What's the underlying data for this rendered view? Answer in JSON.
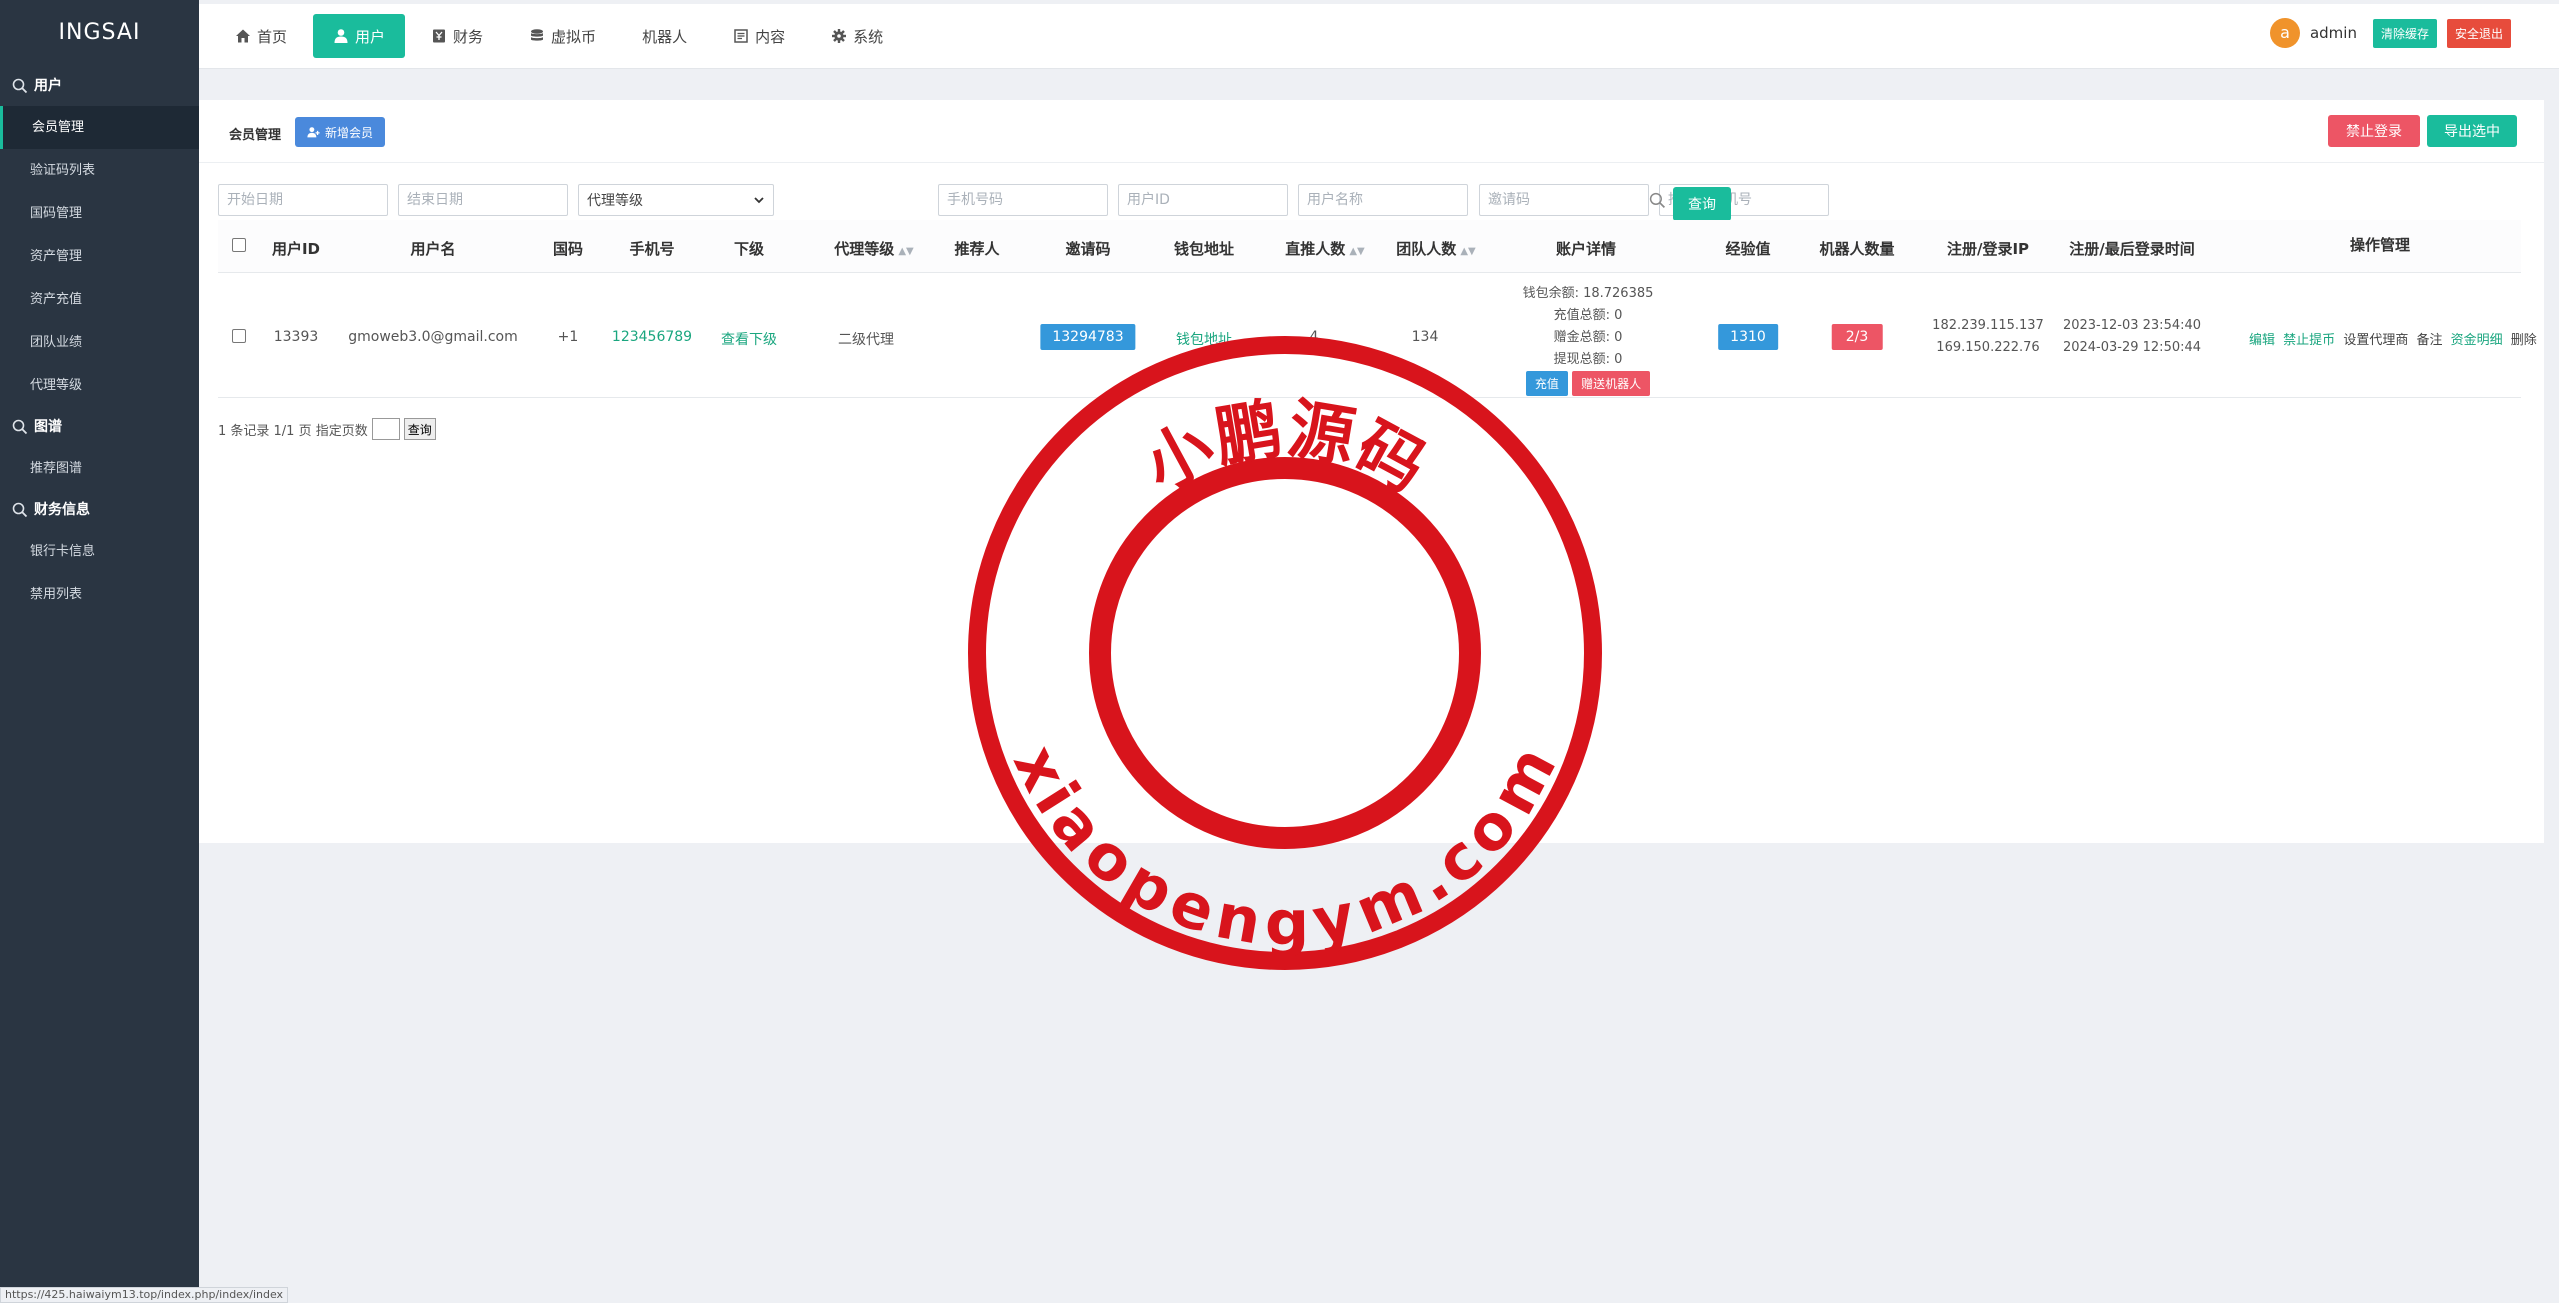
{
  "brand": "INGSAI",
  "sidebar": {
    "groups": [
      {
        "label": "用户",
        "items": [
          "会员管理",
          "验证码列表",
          "国码管理",
          "资产管理",
          "资产充值",
          "团队业绩",
          "代理等级"
        ]
      },
      {
        "label": "图谱",
        "items": [
          "推荐图谱"
        ]
      },
      {
        "label": "财务信息",
        "items": [
          "银行卡信息",
          "禁用列表"
        ]
      }
    ]
  },
  "topnav": {
    "tabs": [
      "首页",
      "用户",
      "财务",
      "虚拟币",
      "机器人",
      "内容",
      "系统"
    ],
    "avatar_letter": "a",
    "user": "admin",
    "clear_cache": "清除缓存",
    "logout": "安全退出"
  },
  "panel": {
    "title": "会员管理",
    "add_member": "新增会员",
    "ban_login": "禁止登录",
    "export_selected": "导出选中"
  },
  "filters": {
    "start_date": "开始日期",
    "end_date": "结束日期",
    "agent_level": "代理等级",
    "phone": "手机号码",
    "user_id": "用户ID",
    "user_name": "用户名称",
    "invite_code": "邀请码",
    "referrer_phone": "推荐人手机号",
    "query": "查询"
  },
  "table": {
    "headers": [
      "用户ID",
      "用户名",
      "国码",
      "手机号",
      "下级",
      "代理等级",
      "推荐人",
      "邀请码",
      "钱包地址",
      "直推人数",
      "团队人数",
      "账户详情",
      "经验值",
      "机器人数量",
      "注册/登录IP",
      "注册/最后登录时间",
      "操作管理"
    ],
    "row": {
      "id": "13393",
      "username": "gmoweb3.0@gmail.com",
      "country_code": "+1",
      "phone": "123456789",
      "subordinate": "查看下级",
      "agent_level": "二级代理",
      "referrer": "",
      "invite_code": "13294783",
      "wallet": "钱包地址",
      "direct": "4",
      "team": "134",
      "wallet_balance": "钱包余额: 18.726385",
      "recharge_total": "充值总额: 0",
      "gift_total": "赠金总额: 0",
      "withdraw_total": "提现总额: 0",
      "recharge_btn": "充值",
      "gift_robot_btn": "赠送机器人",
      "exp": "1310",
      "robots": "2/3",
      "reg_ip": "182.239.115.137",
      "login_ip": "169.150.222.76",
      "reg_time": "2023-12-03 23:54:40",
      "login_time": "2024-03-29 12:50:44",
      "ops": {
        "edit": "编辑",
        "ban_withdraw": "禁止提币",
        "set_agent": "设置代理商",
        "note": "备注",
        "funds": "资金明细",
        "delete": "删除"
      }
    }
  },
  "pager": {
    "summary": "1 条记录 1/1 页 指定页数",
    "go": "查询"
  },
  "statusbar": "https://425.haiwaiym13.top/index.php/index/index",
  "watermark": {
    "top": "小鹏源码",
    "bottom": "xiaopengym.com"
  },
  "colors": {
    "sidebar": "#2a3542",
    "accent": "#1abc9c",
    "danger": "#ed5565",
    "info": "#3498db",
    "stamp": "#d8141c"
  }
}
